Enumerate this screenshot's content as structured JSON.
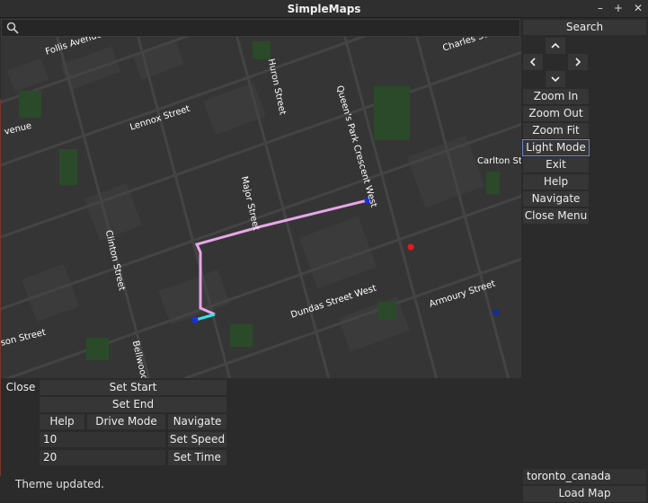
{
  "window": {
    "title": "SimpleMaps",
    "controls": [
      "–",
      "+",
      "✕"
    ]
  },
  "search": {
    "placeholder": "",
    "value": "",
    "button_label": "Search"
  },
  "map": {
    "street_labels": [
      "Follis Avenue",
      "Charles St",
      "Huron Street",
      "Queen's Park Crescent West",
      "Lennox Street",
      "venue",
      "Carlton Str",
      "Major Street",
      "Clinton Street",
      "Armoury Street",
      "Dundas Street West",
      "Bellwoods Av",
      "son Street"
    ]
  },
  "sidebar": {
    "nav_icons": [
      "chevron-up-icon",
      "chevron-left-icon",
      "chevron-right-icon",
      "chevron-down-icon"
    ],
    "items": [
      "Zoom In",
      "Zoom Out",
      "Zoom Fit",
      "Light Mode",
      "Exit",
      "Help",
      "Navigate",
      "Close Menu"
    ]
  },
  "route_panel": {
    "close_label": "Close",
    "set_start_label": "Set Start",
    "set_end_label": "Set End",
    "help_label": "Help",
    "drive_mode_label": "Drive Mode",
    "navigate_label": "Navigate",
    "speed_value": "10",
    "set_speed_label": "Set Speed",
    "time_value": "20",
    "set_time_label": "Set Time"
  },
  "map_loader": {
    "map_name": "toronto_canada",
    "load_label": "Load Map"
  },
  "status": {
    "message": "Theme updated."
  },
  "colors": {
    "route": "#e8a6e8",
    "route_start_segment": "#2ee6e6",
    "marker_start": "#1a2ee6",
    "marker_poi": "#e61a1a",
    "park": "#2a4a2a"
  }
}
